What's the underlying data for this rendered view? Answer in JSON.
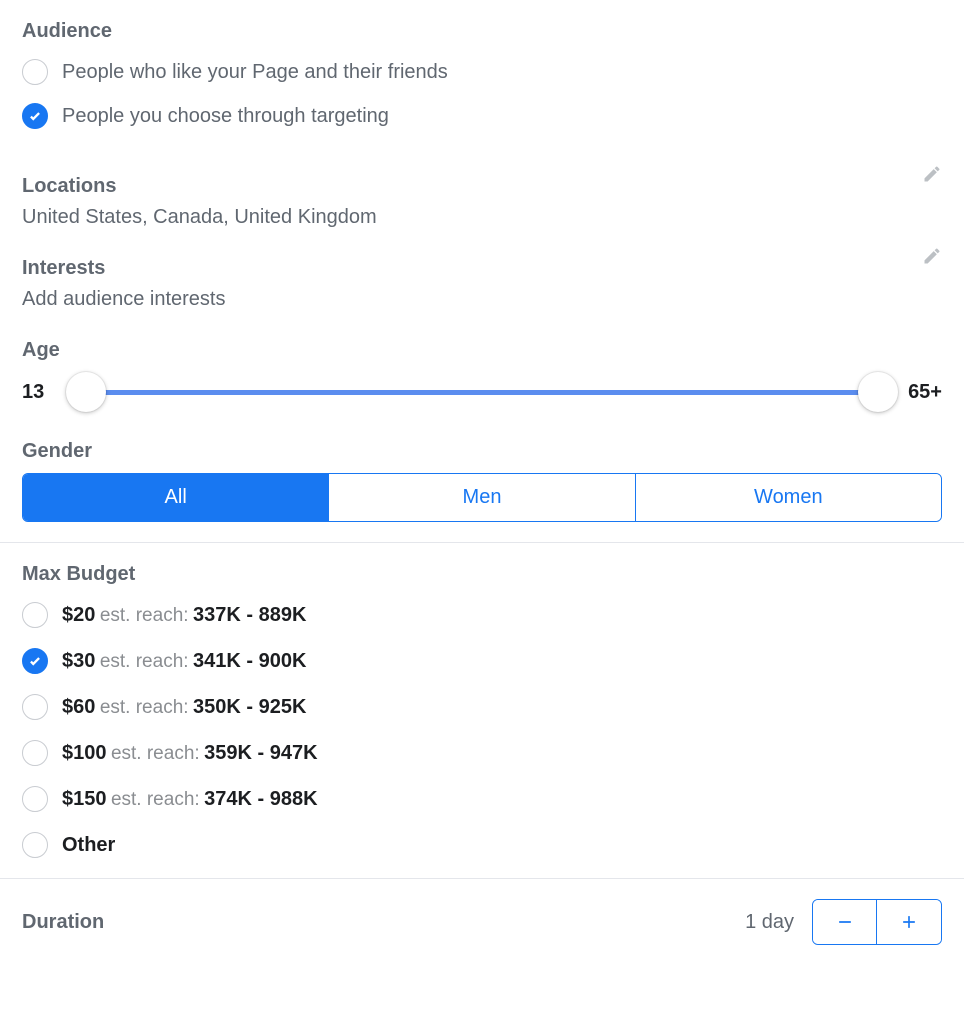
{
  "audience": {
    "title": "Audience",
    "options": [
      {
        "label": "People who like your Page and their friends",
        "checked": false
      },
      {
        "label": "People you choose through targeting",
        "checked": true
      }
    ]
  },
  "locations": {
    "title": "Locations",
    "value": "United States, Canada, United Kingdom"
  },
  "interests": {
    "title": "Interests",
    "placeholder": "Add audience interests"
  },
  "age": {
    "title": "Age",
    "min": "13",
    "max": "65+"
  },
  "gender": {
    "title": "Gender",
    "options": [
      "All",
      "Men",
      "Women"
    ],
    "selected": "All"
  },
  "budget": {
    "title": "Max Budget",
    "reach_label": "est. reach:",
    "options": [
      {
        "price": "$20",
        "reach": "337K - 889K",
        "checked": false
      },
      {
        "price": "$30",
        "reach": "341K - 900K",
        "checked": true
      },
      {
        "price": "$60",
        "reach": "350K - 925K",
        "checked": false
      },
      {
        "price": "$100",
        "reach": "359K - 947K",
        "checked": false
      },
      {
        "price": "$150",
        "reach": "374K - 988K",
        "checked": false
      }
    ],
    "other_label": "Other"
  },
  "duration": {
    "title": "Duration",
    "value": "1 day"
  }
}
